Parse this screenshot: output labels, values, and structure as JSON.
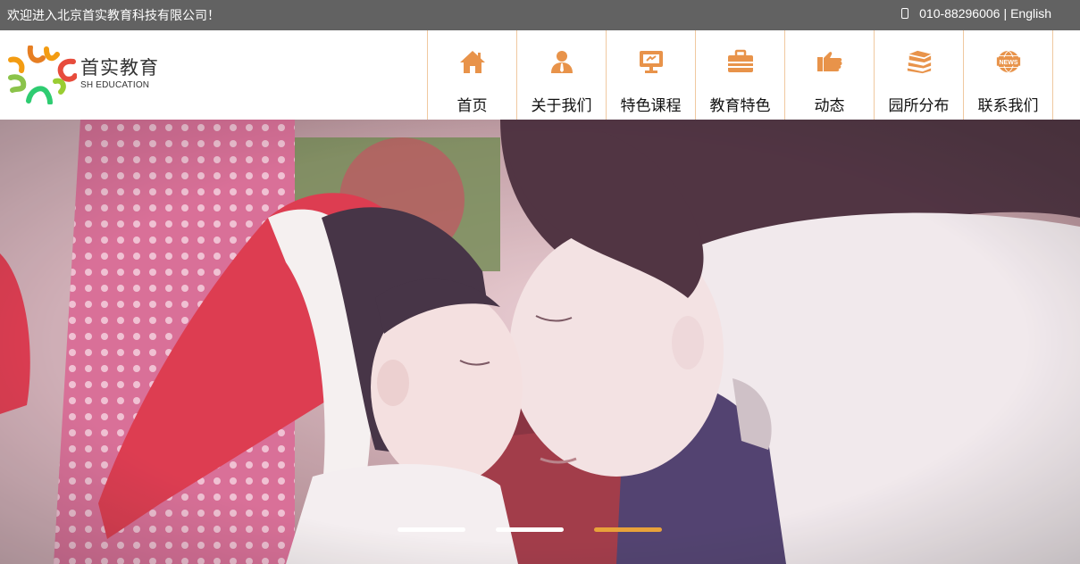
{
  "topbar": {
    "welcome": "欢迎进入北京首实教育科技有限公司！",
    "phone": "010-88296006",
    "separator": "|",
    "language": "English"
  },
  "logo": {
    "name_cn": "首实教育",
    "name_en": "SH EDUCATION"
  },
  "nav": {
    "accent_color": "#e8934a",
    "items": [
      {
        "label": "首页",
        "icon": "home-icon"
      },
      {
        "label": "关于我们",
        "icon": "person-icon"
      },
      {
        "label": "特色课程",
        "icon": "monitor-icon"
      },
      {
        "label": "教育特色",
        "icon": "briefcase-icon"
      },
      {
        "label": "动态",
        "icon": "hand-icon"
      },
      {
        "label": "园所分布",
        "icon": "books-icon"
      },
      {
        "label": "联系我们",
        "icon": "news-globe-icon"
      }
    ]
  },
  "hero": {
    "slide_count": 3,
    "active_slide": 3,
    "globe_text": "NEWS"
  }
}
